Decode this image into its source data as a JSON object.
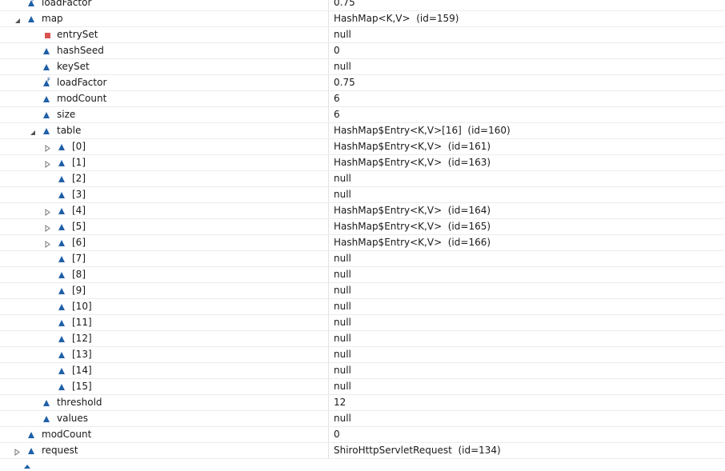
{
  "variables": {
    "rows": [
      {
        "label": "loadFactor",
        "value": "0.75"
      },
      {
        "label": "map",
        "value": "HashMap<K,V>  (id=159)"
      },
      {
        "label": "entrySet",
        "value": "null"
      },
      {
        "label": "hashSeed",
        "value": "0"
      },
      {
        "label": "keySet",
        "value": "null"
      },
      {
        "label": "loadFactor",
        "value": "0.75"
      },
      {
        "label": "modCount",
        "value": "6"
      },
      {
        "label": "size",
        "value": "6"
      },
      {
        "label": "table",
        "value": "HashMap$Entry<K,V>[16]  (id=160)"
      },
      {
        "label": "[0]",
        "value": "HashMap$Entry<K,V>  (id=161)"
      },
      {
        "label": "[1]",
        "value": "HashMap$Entry<K,V>  (id=163)"
      },
      {
        "label": "[2]",
        "value": "null"
      },
      {
        "label": "[3]",
        "value": "null"
      },
      {
        "label": "[4]",
        "value": "HashMap$Entry<K,V>  (id=164)"
      },
      {
        "label": "[5]",
        "value": "HashMap$Entry<K,V>  (id=165)"
      },
      {
        "label": "[6]",
        "value": "HashMap$Entry<K,V>  (id=166)"
      },
      {
        "label": "[7]",
        "value": "null"
      },
      {
        "label": "[8]",
        "value": "null"
      },
      {
        "label": "[9]",
        "value": "null"
      },
      {
        "label": "[10]",
        "value": "null"
      },
      {
        "label": "[11]",
        "value": "null"
      },
      {
        "label": "[12]",
        "value": "null"
      },
      {
        "label": "[13]",
        "value": "null"
      },
      {
        "label": "[14]",
        "value": "null"
      },
      {
        "label": "[15]",
        "value": "null"
      },
      {
        "label": "threshold",
        "value": "12"
      },
      {
        "label": "values",
        "value": "null"
      },
      {
        "label": "modCount",
        "value": "0"
      },
      {
        "label": "request",
        "value": "ShiroHttpServletRequest  (id=134)"
      }
    ]
  },
  "icons": {
    "field_icon": "triangle-field-icon",
    "private_field_icon": "square-private-field-icon",
    "final_badge": "F",
    "expanded_twisty": "expanded-arrow-icon",
    "collapsed_twisty": "collapsed-arrow-icon"
  },
  "colors": {
    "field_blue": "#1f5fa8",
    "private_red": "#d9534f",
    "row_border": "#ececec",
    "divider": "#e3e3e3"
  }
}
